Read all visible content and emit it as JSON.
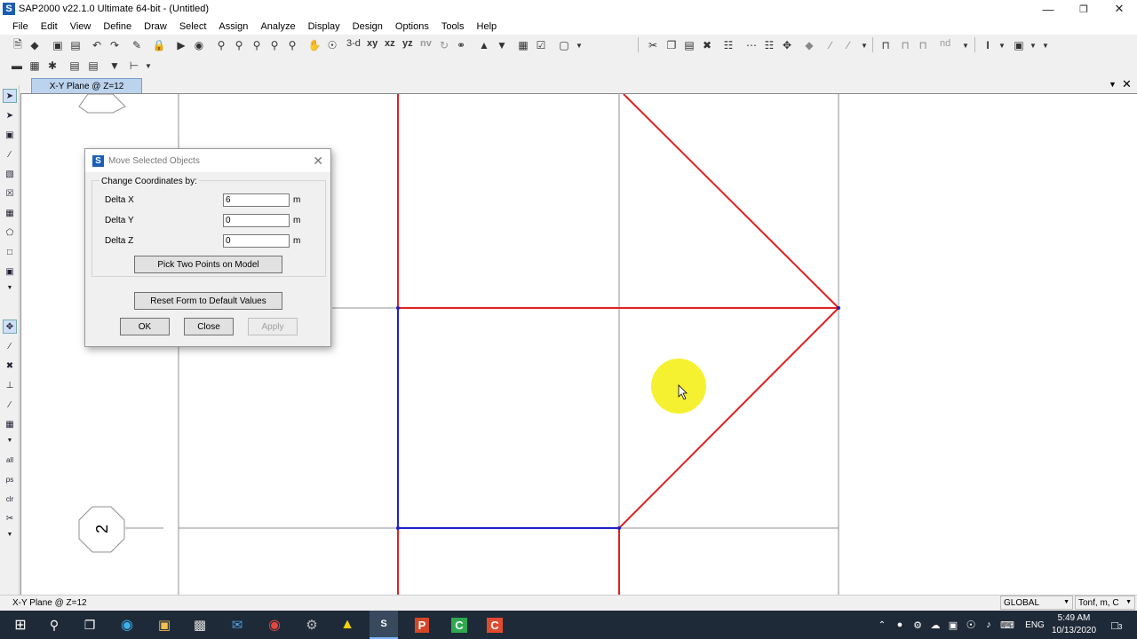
{
  "window": {
    "title": "SAP2000 v22.1.0 Ultimate 64-bit - (Untitled)",
    "logo": "S"
  },
  "menu": [
    "File",
    "Edit",
    "View",
    "Define",
    "Draw",
    "Select",
    "Assign",
    "Analyze",
    "Display",
    "Design",
    "Options",
    "Tools",
    "Help"
  ],
  "toolbar": {
    "view_3d": "3-d",
    "view_xy": "xy",
    "view_xz": "xz",
    "view_yz": "yz",
    "view_nv": "nv",
    "nd": "nd"
  },
  "tab": {
    "label": "X-Y Plane @ Z=12"
  },
  "canvas": {
    "grid_bubble_label": "2"
  },
  "dialog": {
    "title": "Move Selected Objects",
    "group_label": "Change Coordinates by:",
    "fields": [
      {
        "label": "Delta X",
        "value": "6",
        "unit": "m"
      },
      {
        "label": "Delta Y",
        "value": "0",
        "unit": "m"
      },
      {
        "label": "Delta Z",
        "value": "0",
        "unit": "m"
      }
    ],
    "pick_button": "Pick Two Points on Model",
    "reset_button": "Reset Form to Default Values",
    "ok_button": "OK",
    "close_button": "Close",
    "apply_button": "Apply"
  },
  "status": {
    "left": "X-Y Plane @ Z=12",
    "coord_system": "GLOBAL",
    "units": "Tonf, m, C"
  },
  "taskbar": {
    "language": "ENG",
    "time": "5:49 AM",
    "date": "10/13/2020",
    "notifications": "3"
  },
  "colors": {
    "frame_red": "#e02020",
    "frame_blue": "#2020c8",
    "grid": "#909090",
    "cursor_highlight": "#f5f01a"
  }
}
